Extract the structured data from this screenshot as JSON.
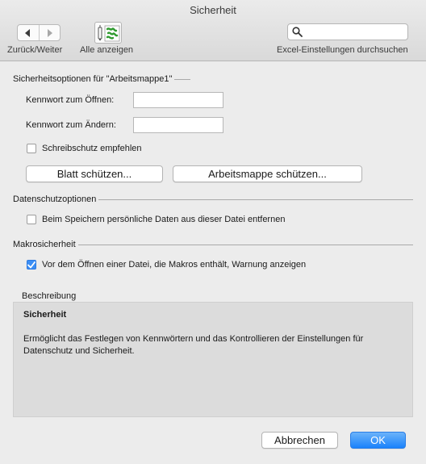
{
  "window": {
    "title": "Sicherheit"
  },
  "toolbar": {
    "back_forward_label": "Zurück/Weiter",
    "show_all_label": "Alle anzeigen",
    "search_label": "Excel-Einstellungen durchsuchen",
    "search_value": "",
    "icons": {
      "back": "chevron-left-icon",
      "forward": "chevron-right-icon",
      "app": "excel-preferences-icon",
      "search": "search-icon"
    }
  },
  "security_options": {
    "heading": "Sicherheitsoptionen für \"Arbeitsmappe1\"",
    "open_password_label": "Kennwort zum Öffnen:",
    "open_password_value": "",
    "modify_password_label": "Kennwort zum Ändern:",
    "modify_password_value": "",
    "readonly_label": "Schreibschutz empfehlen",
    "readonly_checked": false,
    "protect_sheet_button": "Blatt schützen...",
    "protect_workbook_button": "Arbeitsmappe schützen..."
  },
  "privacy": {
    "heading": "Datenschutzoptionen",
    "remove_personal_label": "Beim Speichern persönliche Daten aus dieser Datei entfernen",
    "remove_personal_checked": false
  },
  "macro": {
    "heading": "Makrosicherheit",
    "warn_label": "Vor dem Öffnen einer Datei, die Makros enthält, Warnung anzeigen",
    "warn_checked": true
  },
  "description": {
    "label": "Beschreibung",
    "title": "Sicherheit",
    "text": "Ermöglicht das Festlegen von Kennwörtern und das Kontrollieren der Einstellungen für Datenschutz und Sicherheit."
  },
  "footer": {
    "cancel_button": "Abbrechen",
    "ok_button": "OK"
  },
  "colors": {
    "accent": "#1a82fb",
    "checkbox_checked": "#3b8ef5",
    "description_bg": "#dcdcdc"
  }
}
